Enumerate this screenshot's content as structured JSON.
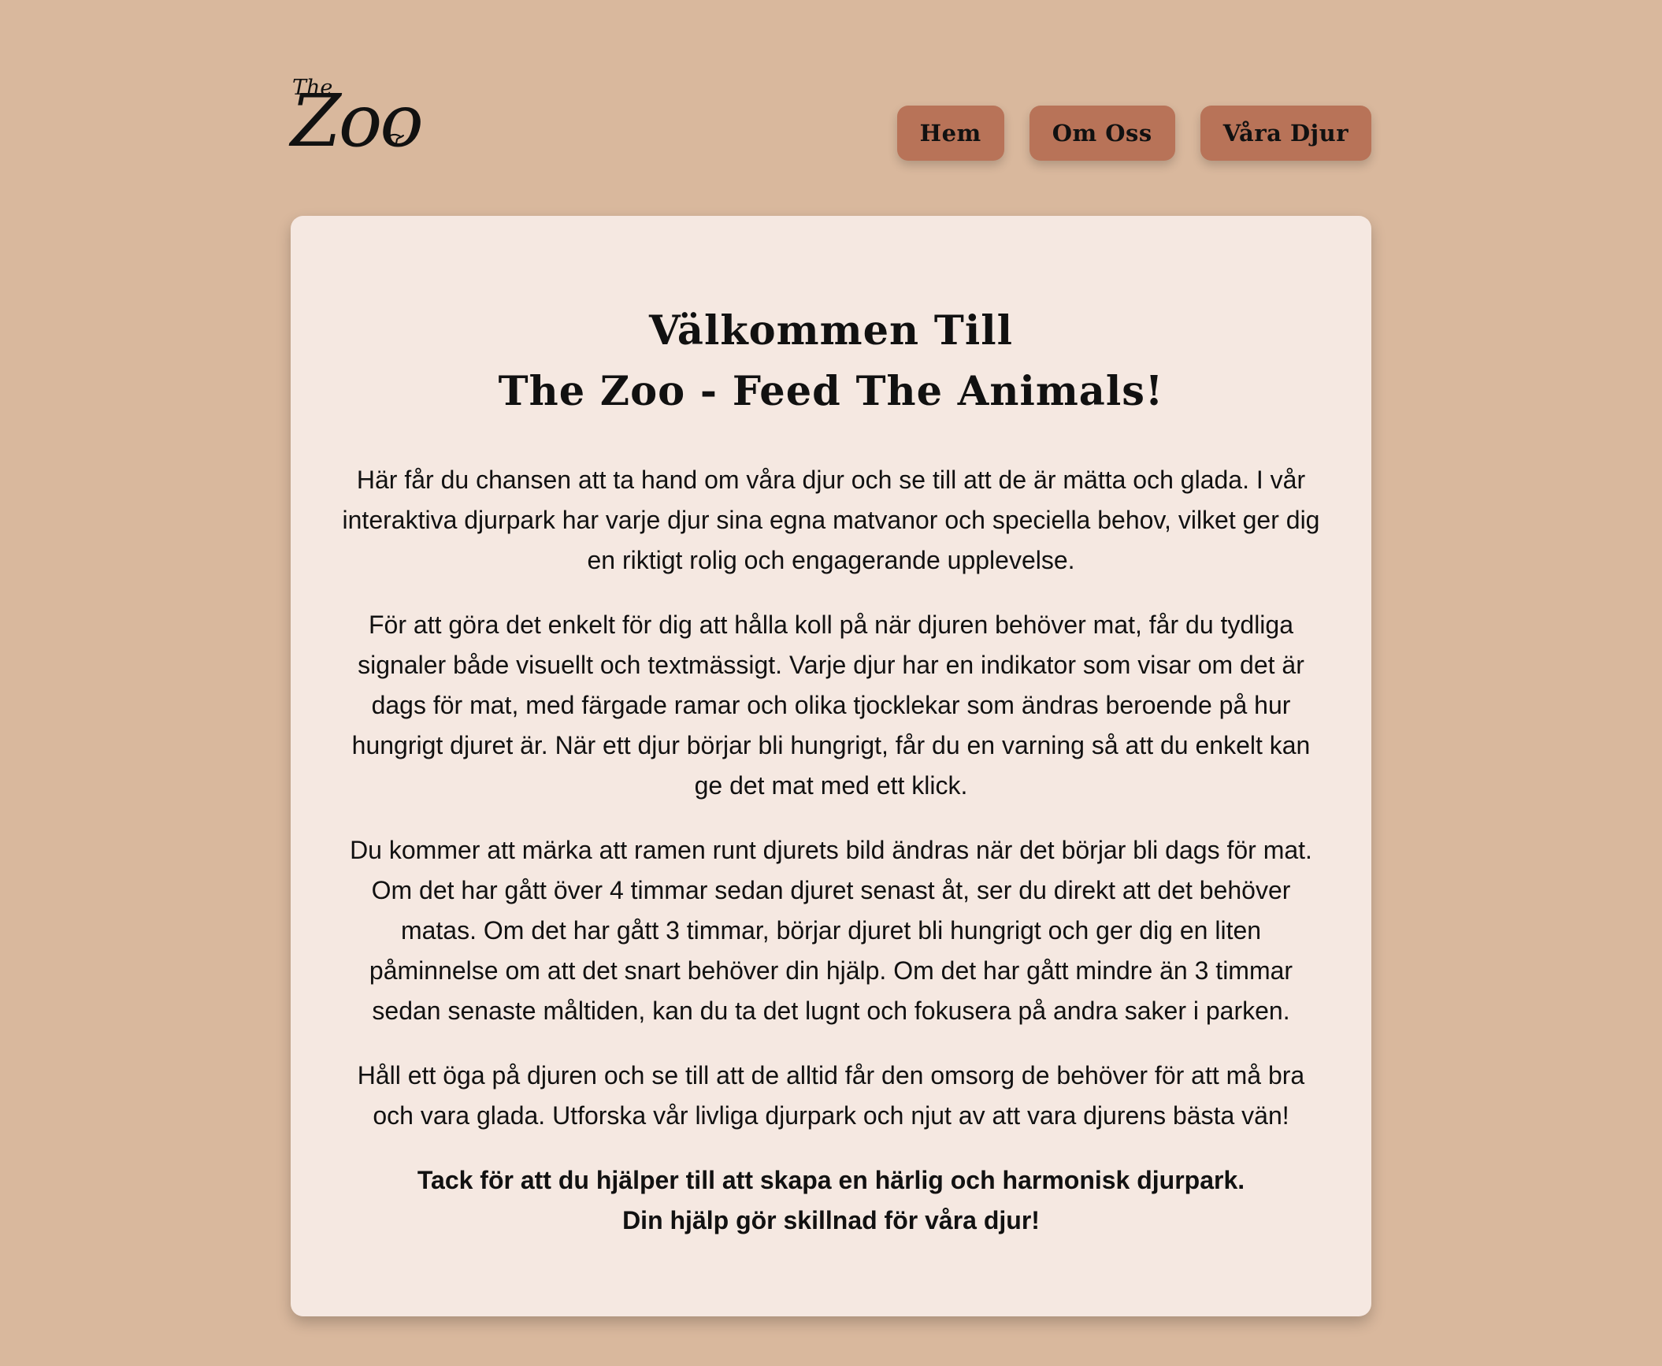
{
  "logo": {
    "the": "The",
    "zoo": "Zoo"
  },
  "nav": {
    "items": [
      "Hem",
      "Om Oss",
      "Våra Djur"
    ]
  },
  "content": {
    "title_line1": "Välkommen Till",
    "title_line2": "The Zoo - Feed The Animals!",
    "paragraphs": [
      "Här får du chansen att ta hand om våra djur och se till att de är mätta och glada. I vår interaktiva djurpark har varje djur sina egna matvanor och speciella behov, vilket ger dig en riktigt rolig och engagerande upplevelse.",
      "För att göra det enkelt för dig att hålla koll på när djuren behöver mat, får du tydliga signaler både visuellt och textmässigt. Varje djur har en indikator som visar om det är dags för mat, med färgade ramar och olika tjocklekar som ändras beroende på hur hungrigt djuret är. När ett djur börjar bli hungrigt, får du en varning så att du enkelt kan ge det mat med ett klick.",
      "Du kommer att märka att ramen runt djurets bild ändras när det börjar bli dags för mat. Om det har gått över 4 timmar sedan djuret senast åt, ser du direkt att det behöver matas. Om det har gått 3 timmar, börjar djuret bli hungrigt och ger dig en liten påminnelse om att det snart behöver din hjälp. Om det har gått mindre än 3 timmar sedan senaste måltiden, kan du ta det lugnt och fokusera på andra saker i parken.",
      "Håll ett öga på djuren och se till att de alltid får den omsorg de behöver för att må bra och vara glada. Utforska vår livliga djurpark och njut av att vara djurens bästa vän!"
    ],
    "thanks_line1": "Tack för att du hjälper till att skapa en härlig och harmonisk djurpark.",
    "thanks_line2": "Din hjälp gör skillnad för våra djur!"
  },
  "colors": {
    "background": "#d9b89d",
    "card": "#f5e8e1",
    "button": "#b87358"
  }
}
